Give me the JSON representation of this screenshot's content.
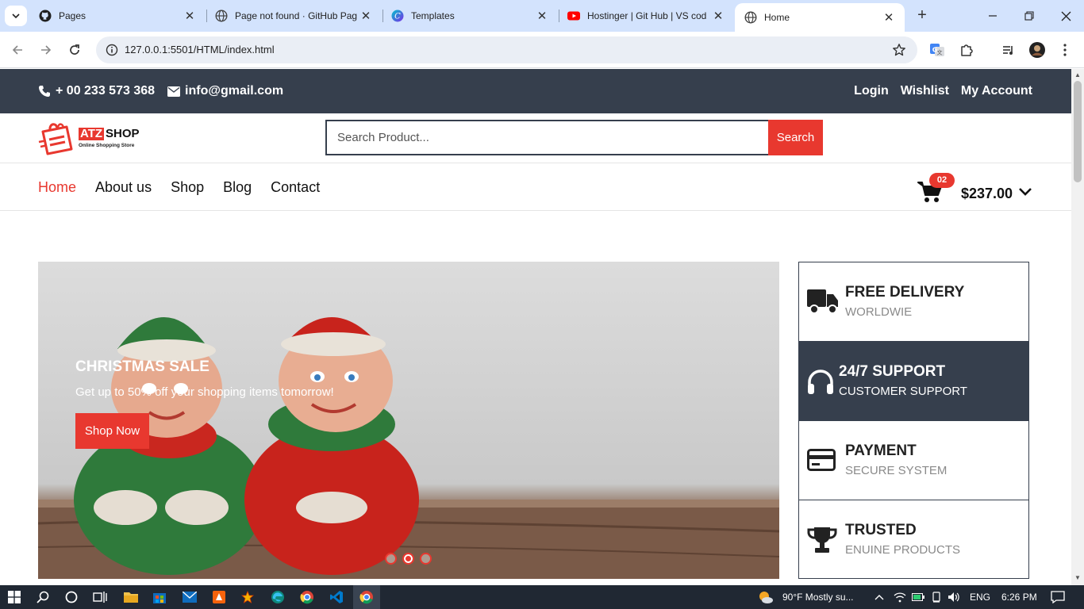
{
  "browser": {
    "tabs": [
      {
        "title": "Pages",
        "icon": "github-icon"
      },
      {
        "title": "Page not found · GitHub Pag",
        "icon": "globe-icon"
      },
      {
        "title": "Templates",
        "icon": "canva-icon"
      },
      {
        "title": "Hostinger | Git Hub | VS cod",
        "icon": "youtube-icon"
      },
      {
        "title": "Home",
        "icon": "globe-icon",
        "active": true
      }
    ],
    "url": "127.0.0.1:5501/HTML/index.html"
  },
  "site": {
    "topbar": {
      "phone": "+ 00 233 573 368",
      "email": "info@gmail.com",
      "links": [
        "Login",
        "Wishlist",
        "My Account"
      ]
    },
    "logo": {
      "atz": "ATZ",
      "shop": "SHOP",
      "tagline": "Online Shopping Store"
    },
    "search": {
      "placeholder": "Search Product...",
      "button": "Search"
    },
    "nav": [
      "Home",
      "About us",
      "Shop",
      "Blog",
      "Contact"
    ],
    "cart": {
      "count": "02",
      "total": "$237.00"
    },
    "slider": {
      "title": "CHRISTMAS SALE",
      "text": "Get up to 50% off your shopping items tomorrow!",
      "cta": "Shop Now",
      "active_slide": 2,
      "slide_count": 3
    },
    "features": [
      {
        "title": "FREE DELIVERY",
        "subtitle": "WORLDWIE",
        "icon": "truck-icon"
      },
      {
        "title": "24/7 SUPPORT",
        "subtitle": "CUSTOMER SUPPORT",
        "icon": "headphones-icon"
      },
      {
        "title": "PAYMENT",
        "subtitle": "SECURE SYSTEM",
        "icon": "credit-card-icon"
      },
      {
        "title": "TRUSTED",
        "subtitle": "ENUINE PRODUCTS",
        "icon": "trophy-icon"
      }
    ]
  },
  "taskbar": {
    "weather": "90°F  Mostly su...",
    "lang": "ENG",
    "time": "6:26 PM"
  },
  "colors": {
    "accent": "#e8382f",
    "dark": "#363f4d",
    "tabstrip": "#d3e3fd"
  }
}
